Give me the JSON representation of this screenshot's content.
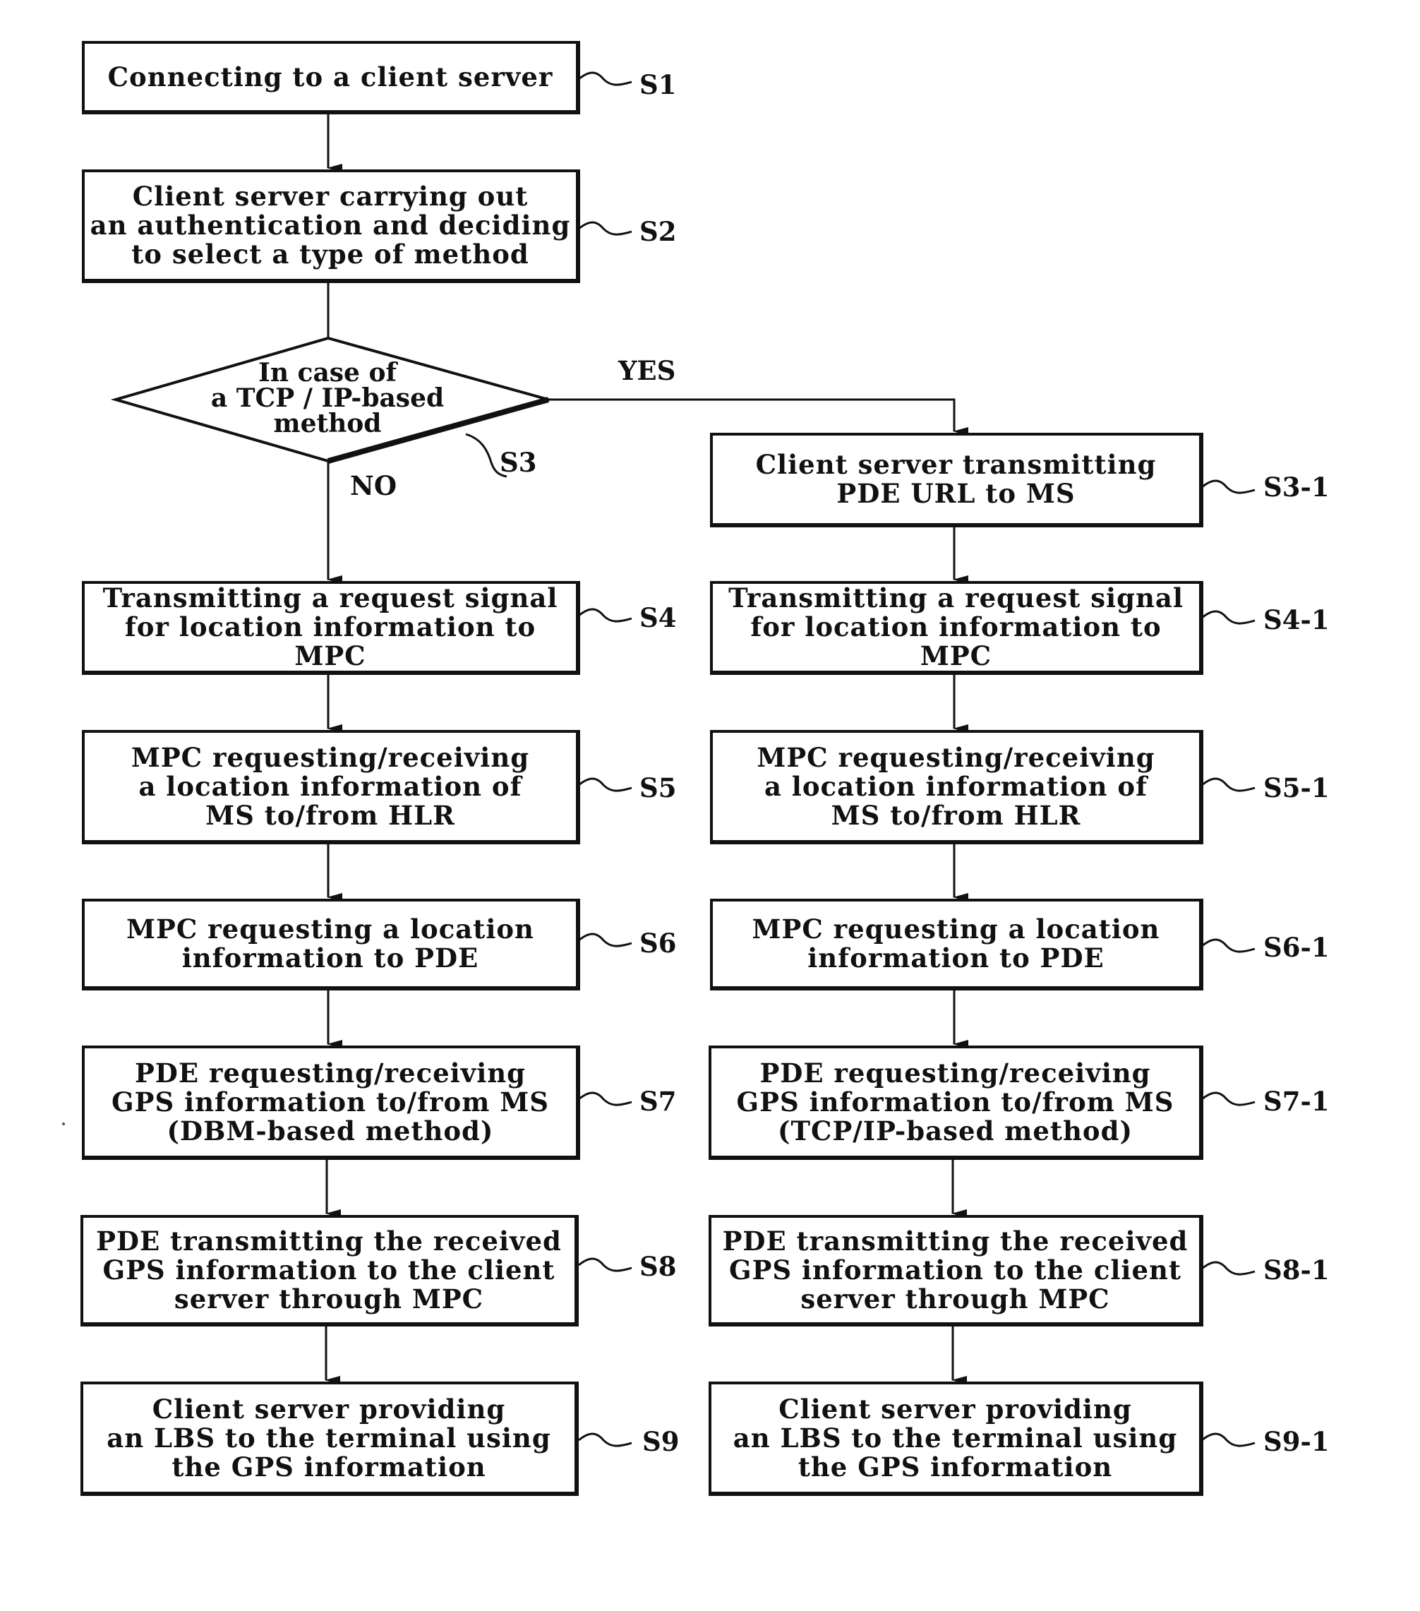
{
  "diagram": {
    "type": "flowchart",
    "decision": {
      "id": "S3",
      "text": "In case of\na TCP / IP-based\nmethod",
      "yes_label": "YES",
      "no_label": "NO"
    },
    "steps": {
      "S1": {
        "id": "S1",
        "text": "Connecting to a client server"
      },
      "S2": {
        "id": "S2",
        "text": "Client server carrying out\nan authentication and deciding\nto select a type of method"
      },
      "S4": {
        "id": "S4",
        "text": "Transmitting a request signal\nfor location information to MPC"
      },
      "S5": {
        "id": "S5",
        "text": "MPC requesting/receiving\na location information of\nMS to/from HLR"
      },
      "S6": {
        "id": "S6",
        "text": "MPC requesting a location\ninformation to PDE"
      },
      "S7": {
        "id": "S7",
        "text": "PDE requesting/receiving\nGPS information to/from MS\n(DBM-based method)"
      },
      "S8": {
        "id": "S8",
        "text": "PDE transmitting the received\nGPS information to the client\nserver through MPC"
      },
      "S9": {
        "id": "S9",
        "text": "Client server providing\nan LBS to the terminal using\nthe GPS information"
      },
      "S3_1": {
        "id": "S3-1",
        "text": "Client server transmitting\nPDE URL to MS"
      },
      "S4_1": {
        "id": "S4-1",
        "text": "Transmitting a request signal\nfor location information to MPC"
      },
      "S5_1": {
        "id": "S5-1",
        "text": "MPC requesting/receiving\na location information of\nMS to/from HLR"
      },
      "S6_1": {
        "id": "S6-1",
        "text": "MPC requesting a location\ninformation to PDE"
      },
      "S7_1": {
        "id": "S7-1",
        "text": "PDE requesting/receiving\nGPS information to/from MS\n(TCP/IP-based method)"
      },
      "S8_1": {
        "id": "S8-1",
        "text": "PDE transmitting the received\nGPS information to the client\nserver through MPC"
      },
      "S9_1": {
        "id": "S9-1",
        "text": "Client server providing\nan LBS to the terminal using\nthe GPS information"
      }
    },
    "flow": {
      "main": [
        "S1",
        "S2",
        "S3"
      ],
      "no_branch": [
        "S4",
        "S5",
        "S6",
        "S7",
        "S8",
        "S9"
      ],
      "yes_branch": [
        "S3-1",
        "S4-1",
        "S5-1",
        "S6-1",
        "S7-1",
        "S8-1",
        "S9-1"
      ]
    }
  }
}
